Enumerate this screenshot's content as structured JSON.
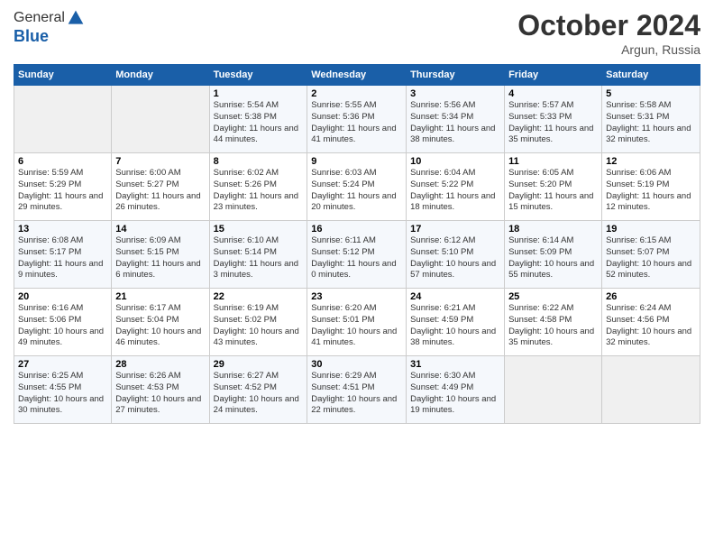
{
  "header": {
    "logo_line1": "General",
    "logo_line2": "Blue",
    "month": "October 2024",
    "location": "Argun, Russia"
  },
  "days_of_week": [
    "Sunday",
    "Monday",
    "Tuesday",
    "Wednesday",
    "Thursday",
    "Friday",
    "Saturday"
  ],
  "weeks": [
    [
      {
        "day": "",
        "detail": ""
      },
      {
        "day": "",
        "detail": ""
      },
      {
        "day": "1",
        "detail": "Sunrise: 5:54 AM\nSunset: 5:38 PM\nDaylight: 11 hours and 44 minutes."
      },
      {
        "day": "2",
        "detail": "Sunrise: 5:55 AM\nSunset: 5:36 PM\nDaylight: 11 hours and 41 minutes."
      },
      {
        "day": "3",
        "detail": "Sunrise: 5:56 AM\nSunset: 5:34 PM\nDaylight: 11 hours and 38 minutes."
      },
      {
        "day": "4",
        "detail": "Sunrise: 5:57 AM\nSunset: 5:33 PM\nDaylight: 11 hours and 35 minutes."
      },
      {
        "day": "5",
        "detail": "Sunrise: 5:58 AM\nSunset: 5:31 PM\nDaylight: 11 hours and 32 minutes."
      }
    ],
    [
      {
        "day": "6",
        "detail": "Sunrise: 5:59 AM\nSunset: 5:29 PM\nDaylight: 11 hours and 29 minutes."
      },
      {
        "day": "7",
        "detail": "Sunrise: 6:00 AM\nSunset: 5:27 PM\nDaylight: 11 hours and 26 minutes."
      },
      {
        "day": "8",
        "detail": "Sunrise: 6:02 AM\nSunset: 5:26 PM\nDaylight: 11 hours and 23 minutes."
      },
      {
        "day": "9",
        "detail": "Sunrise: 6:03 AM\nSunset: 5:24 PM\nDaylight: 11 hours and 20 minutes."
      },
      {
        "day": "10",
        "detail": "Sunrise: 6:04 AM\nSunset: 5:22 PM\nDaylight: 11 hours and 18 minutes."
      },
      {
        "day": "11",
        "detail": "Sunrise: 6:05 AM\nSunset: 5:20 PM\nDaylight: 11 hours and 15 minutes."
      },
      {
        "day": "12",
        "detail": "Sunrise: 6:06 AM\nSunset: 5:19 PM\nDaylight: 11 hours and 12 minutes."
      }
    ],
    [
      {
        "day": "13",
        "detail": "Sunrise: 6:08 AM\nSunset: 5:17 PM\nDaylight: 11 hours and 9 minutes."
      },
      {
        "day": "14",
        "detail": "Sunrise: 6:09 AM\nSunset: 5:15 PM\nDaylight: 11 hours and 6 minutes."
      },
      {
        "day": "15",
        "detail": "Sunrise: 6:10 AM\nSunset: 5:14 PM\nDaylight: 11 hours and 3 minutes."
      },
      {
        "day": "16",
        "detail": "Sunrise: 6:11 AM\nSunset: 5:12 PM\nDaylight: 11 hours and 0 minutes."
      },
      {
        "day": "17",
        "detail": "Sunrise: 6:12 AM\nSunset: 5:10 PM\nDaylight: 10 hours and 57 minutes."
      },
      {
        "day": "18",
        "detail": "Sunrise: 6:14 AM\nSunset: 5:09 PM\nDaylight: 10 hours and 55 minutes."
      },
      {
        "day": "19",
        "detail": "Sunrise: 6:15 AM\nSunset: 5:07 PM\nDaylight: 10 hours and 52 minutes."
      }
    ],
    [
      {
        "day": "20",
        "detail": "Sunrise: 6:16 AM\nSunset: 5:06 PM\nDaylight: 10 hours and 49 minutes."
      },
      {
        "day": "21",
        "detail": "Sunrise: 6:17 AM\nSunset: 5:04 PM\nDaylight: 10 hours and 46 minutes."
      },
      {
        "day": "22",
        "detail": "Sunrise: 6:19 AM\nSunset: 5:02 PM\nDaylight: 10 hours and 43 minutes."
      },
      {
        "day": "23",
        "detail": "Sunrise: 6:20 AM\nSunset: 5:01 PM\nDaylight: 10 hours and 41 minutes."
      },
      {
        "day": "24",
        "detail": "Sunrise: 6:21 AM\nSunset: 4:59 PM\nDaylight: 10 hours and 38 minutes."
      },
      {
        "day": "25",
        "detail": "Sunrise: 6:22 AM\nSunset: 4:58 PM\nDaylight: 10 hours and 35 minutes."
      },
      {
        "day": "26",
        "detail": "Sunrise: 6:24 AM\nSunset: 4:56 PM\nDaylight: 10 hours and 32 minutes."
      }
    ],
    [
      {
        "day": "27",
        "detail": "Sunrise: 6:25 AM\nSunset: 4:55 PM\nDaylight: 10 hours and 30 minutes."
      },
      {
        "day": "28",
        "detail": "Sunrise: 6:26 AM\nSunset: 4:53 PM\nDaylight: 10 hours and 27 minutes."
      },
      {
        "day": "29",
        "detail": "Sunrise: 6:27 AM\nSunset: 4:52 PM\nDaylight: 10 hours and 24 minutes."
      },
      {
        "day": "30",
        "detail": "Sunrise: 6:29 AM\nSunset: 4:51 PM\nDaylight: 10 hours and 22 minutes."
      },
      {
        "day": "31",
        "detail": "Sunrise: 6:30 AM\nSunset: 4:49 PM\nDaylight: 10 hours and 19 minutes."
      },
      {
        "day": "",
        "detail": ""
      },
      {
        "day": "",
        "detail": ""
      }
    ]
  ]
}
